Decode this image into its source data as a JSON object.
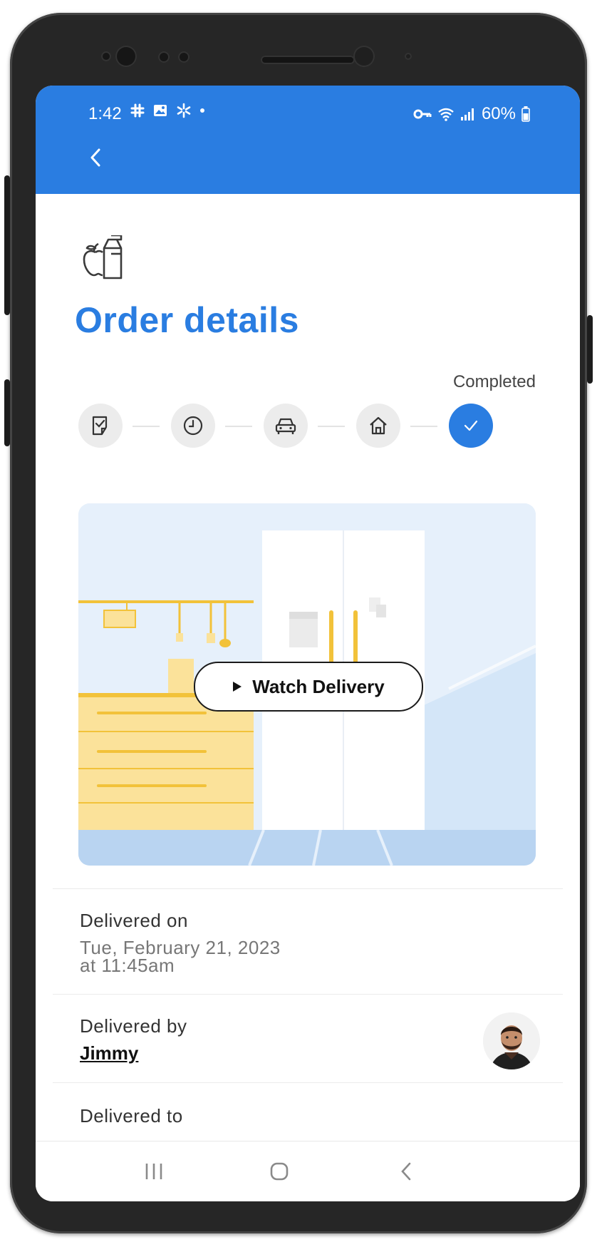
{
  "status_bar": {
    "time": "1:42",
    "battery": "60%"
  },
  "header": {
    "back_icon": "chevron-left-icon"
  },
  "page": {
    "category_icon": "apple-milk-carton-icon",
    "title": "Order details",
    "status": "Completed"
  },
  "progress": {
    "steps": [
      {
        "icon": "receipt-check-icon",
        "state": "done"
      },
      {
        "icon": "clock-icon",
        "state": "done"
      },
      {
        "icon": "car-icon",
        "state": "done"
      },
      {
        "icon": "home-icon",
        "state": "done"
      },
      {
        "icon": "check-icon",
        "state": "current"
      }
    ]
  },
  "video": {
    "button_label": "Watch Delivery"
  },
  "delivered_on": {
    "label": "Delivered on",
    "date": "Tue, February 21, 2023",
    "time": "at 11:45am"
  },
  "delivered_by": {
    "label": "Delivered by",
    "name": "Jimmy"
  },
  "delivered_to": {
    "label": "Delivered to"
  },
  "colors": {
    "brand_blue": "#2a7de1",
    "cabinet_yellow": "#fbe29a"
  }
}
